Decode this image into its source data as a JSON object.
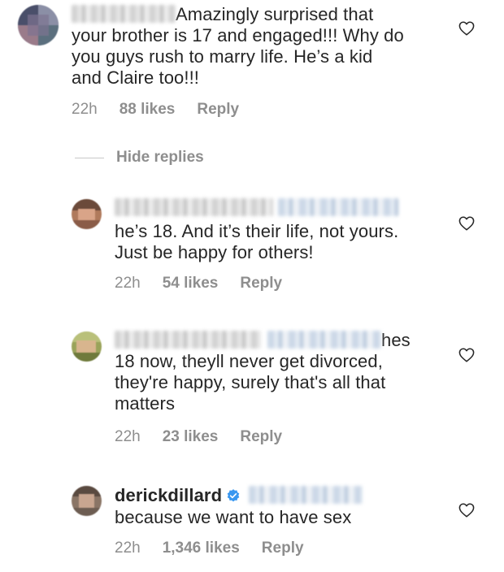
{
  "comments": [
    {
      "text_lines": [
        "Amazingly surprised that",
        "your brother is 17 and engaged!!! Why do",
        "you guys rush to marry life. He’s a kid",
        "and Claire too!!!"
      ],
      "time": "22h",
      "likes": "88 likes",
      "reply": "Reply"
    }
  ],
  "hide_replies_label": "Hide replies",
  "replies": [
    {
      "text_lines": [
        "he’s 18. And it’s their life, not yours.",
        "Just be happy for others!"
      ],
      "time": "22h",
      "likes": "54 likes",
      "reply": "Reply"
    },
    {
      "first_word": "hes",
      "text_lines": [
        "18 now, theyll never get divorced,",
        "they're happy, surely that's all that",
        "matters"
      ],
      "time": "22h",
      "likes": "23 likes",
      "reply": "Reply"
    },
    {
      "username": "derickdillard",
      "text_lines": [
        "because we want to have sex"
      ],
      "time": "22h",
      "likes": "1,346 likes",
      "reply": "Reply"
    }
  ],
  "icons": {
    "like": "heart-outline-icon",
    "verified": "verified-badge-icon"
  },
  "colors": {
    "text": "#262626",
    "muted": "#8e8e8e",
    "verified": "#3897f0"
  }
}
